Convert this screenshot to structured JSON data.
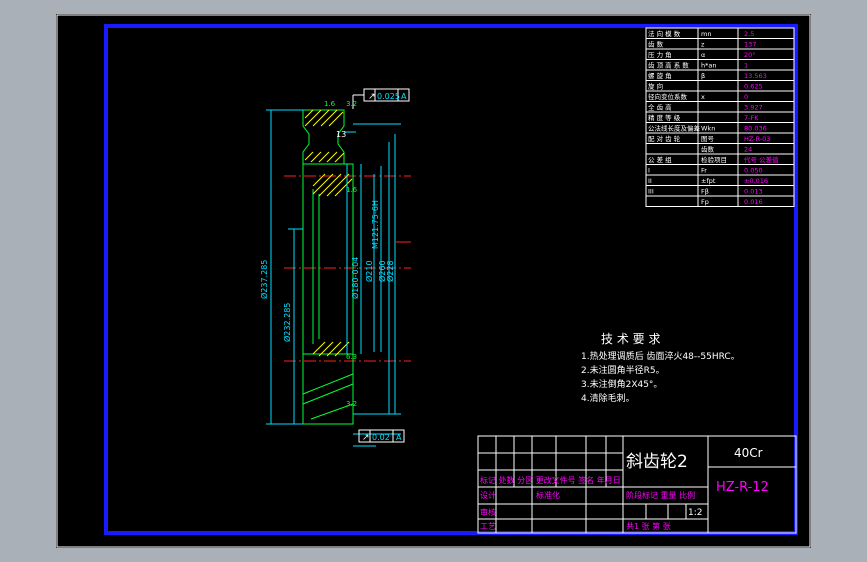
{
  "colors": {
    "background": "#a9b0b8",
    "paper": "#000000",
    "frame": "#1a1aff",
    "outline": "#ffffff",
    "dim": "#00e0ff",
    "part": "#00ff33",
    "hatch": "#ffff00",
    "center": "#ff2020",
    "magenta": "#ff00ff"
  },
  "drawing": {
    "title": "斜齿轮2",
    "material": "40Cr",
    "code": "HZ-R-12",
    "scale": "1:2",
    "title_block_labels": {
      "row1": "标记 处数 分区 更改文件号 签名 年月日",
      "design": "设计",
      "standard": "标准化",
      "stage_cols": "阶段标记 重量 比例",
      "check": "审核",
      "craft": "工艺",
      "sheets": "共1 张 第 张"
    }
  },
  "tech_requirements": {
    "heading": "技 术 要 求",
    "items": [
      "1.热处理调质后 齿面淬火48--55HRC。",
      "2.未注圆角半径R5。",
      "3.未注倒角2X45°。",
      "4.清除毛刺。"
    ]
  },
  "dimensions": {
    "runout_top": "0.025",
    "runout_bottom": "0.02",
    "datum": "A",
    "d_tip": "Ø237.285",
    "d_root": "Ø232.285",
    "d_bore": "Ø180-0.04",
    "d210": "Ø210",
    "d260": "Ø260",
    "d228": "Ø228",
    "thread": "M121.75-6H",
    "width": "13",
    "roughness_marks": [
      "1.6",
      "3.2",
      "1.6",
      "3.2",
      "6.3"
    ]
  },
  "params_table": {
    "rows": [
      {
        "label": "法 向 模 数",
        "sym": "mn",
        "val": "2.5"
      },
      {
        "label": "齿 数",
        "sym": "z",
        "val": "137"
      },
      {
        "label": "压 力 角",
        "sym": "α",
        "val": "20°"
      },
      {
        "label": "齿 顶 高 系 数",
        "sym": "h*an",
        "val": "1"
      },
      {
        "label": "螺 旋 角",
        "sym": "β",
        "val": "13.563"
      },
      {
        "label": "旋 向",
        "sym": "",
        "val": "0.625"
      },
      {
        "label": "径向变位系数",
        "sym": "x",
        "val": "0"
      },
      {
        "label": "全 齿 高",
        "sym": "",
        "val": "3.927"
      },
      {
        "label": "精 度 等 级",
        "sym": "",
        "val": "7-FK"
      },
      {
        "label": "公法线长度及偏差",
        "sym": "Wkn",
        "val": "80.036"
      },
      {
        "label": "配 对 齿 轮",
        "sym": "图号",
        "val": "HZ-R-03"
      },
      {
        "label": "",
        "sym": "齿数",
        "val": "24"
      },
      {
        "label": "公 差 组",
        "sym": "检验项目",
        "val": "代号 公差值"
      },
      {
        "label": "I",
        "sym": "Fr",
        "val": "0.050"
      },
      {
        "label": "II",
        "sym": "±fpt",
        "val": "±0.016"
      },
      {
        "label": "III",
        "sym": "Fβ",
        "val": "0.013"
      },
      {
        "label": "",
        "sym": "Fp",
        "val": "0.016"
      }
    ]
  }
}
